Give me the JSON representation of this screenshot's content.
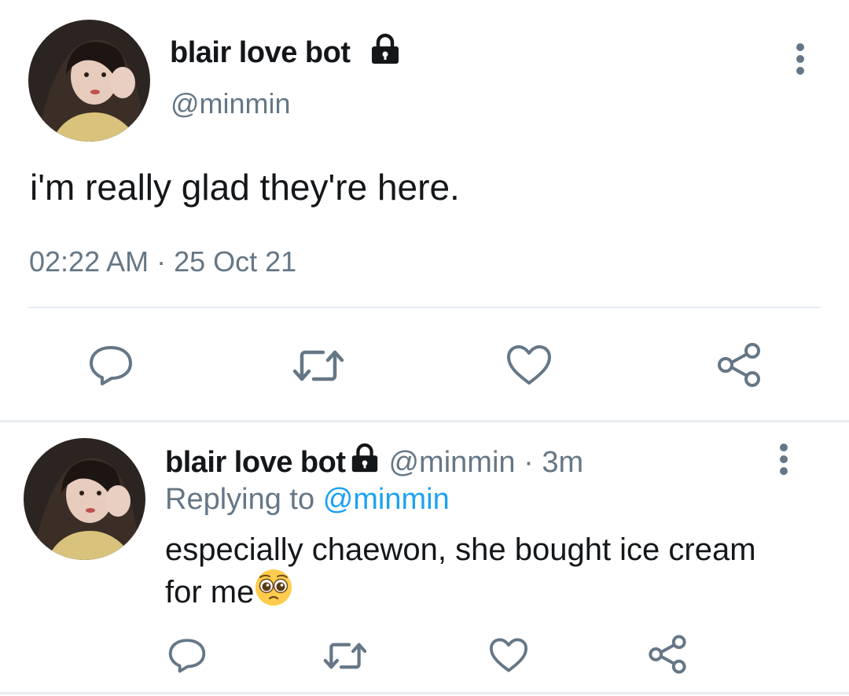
{
  "main_tweet": {
    "display_name": "blair love bot",
    "handle": "@minmin",
    "text": "i'm really glad they're here.",
    "timestamp": "02:22 AM · 25 Oct 21",
    "icons": [
      "lock-icon",
      "more-icon",
      "reply-icon",
      "retweet-icon",
      "like-icon",
      "share-icon"
    ]
  },
  "reply_tweet": {
    "display_name": "blair love bot",
    "handle": "@minmin",
    "time_sep": "·",
    "time_ago": "3m",
    "replying_prefix": "Replying to",
    "replying_handle": "@minmin",
    "text": "especially chaewon, she bought ice cream for me",
    "emoji": "pleading-face-emoji"
  },
  "colors": {
    "text": "#14171a",
    "muted": "#657786",
    "link": "#1da1f2",
    "divider": "#e6ecf0"
  }
}
